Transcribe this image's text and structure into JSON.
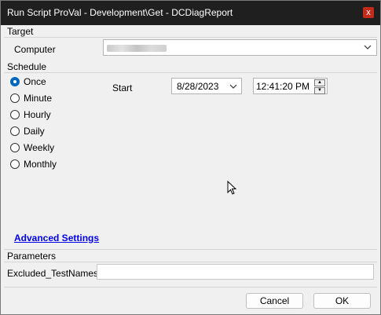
{
  "window": {
    "title": "Run Script ProVal - Development\\Get - DCDiagReport",
    "close_glyph": "x"
  },
  "target": {
    "group_label": "Target",
    "computer_label": "Computer",
    "computer_value": ""
  },
  "schedule": {
    "group_label": "Schedule",
    "options": [
      "Once",
      "Minute",
      "Hourly",
      "Daily",
      "Weekly",
      "Monthly"
    ],
    "selected": "Once",
    "start_label": "Start",
    "start_date": "8/28/2023",
    "start_time": "12:41:20 PM"
  },
  "advanced_settings_link": "Advanced Settings",
  "parameters": {
    "group_label": "Parameters",
    "field_label": "Excluded_TestNames",
    "field_value": ""
  },
  "buttons": {
    "cancel": "Cancel",
    "ok": "OK"
  },
  "icons": {
    "close": "close-icon",
    "dropdown": "chevron-down-icon",
    "spin_up": "up-arrow-icon",
    "spin_down": "down-arrow-icon",
    "cursor": "mouse-pointer-icon"
  }
}
